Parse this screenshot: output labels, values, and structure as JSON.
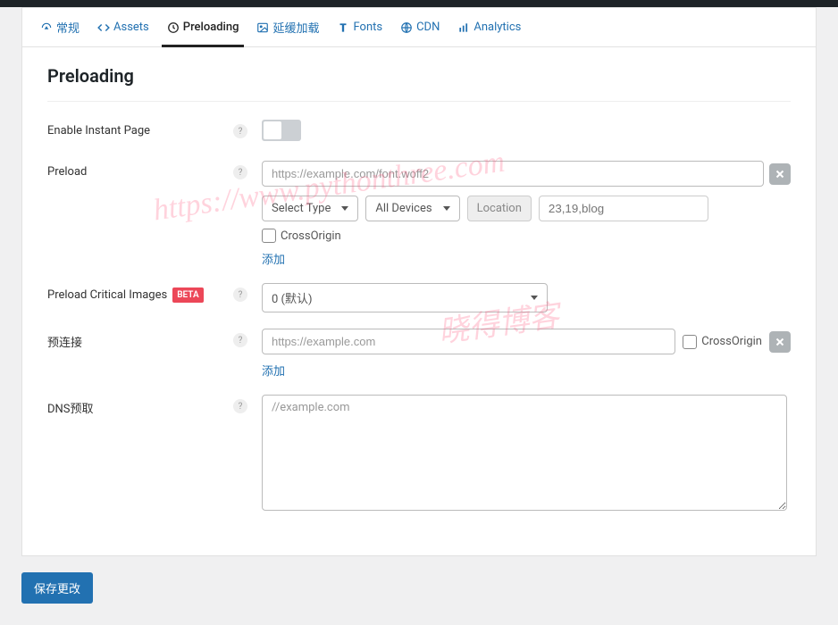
{
  "tabs": {
    "general": "常规",
    "assets": "Assets",
    "preloading": "Preloading",
    "defer": "延缓加载",
    "fonts": "Fonts",
    "cdn": "CDN",
    "analytics": "Analytics"
  },
  "panel": {
    "title": "Preloading"
  },
  "rows": {
    "instant_page": {
      "label": "Enable Instant Page"
    },
    "preload": {
      "label": "Preload",
      "url_placeholder": "https://example.com/font.woff2",
      "select_type": "Select Type",
      "all_devices": "All Devices",
      "location_btn": "Location",
      "location_placeholder": "23,19,blog",
      "crossorigin": "CrossOrigin",
      "add": "添加"
    },
    "preload_critical": {
      "label": "Preload Critical Images",
      "badge": "BETA",
      "value": "0 (默认)"
    },
    "preconnect": {
      "label": "预连接",
      "placeholder": "https://example.com",
      "crossorigin": "CrossOrigin",
      "add": "添加"
    },
    "dns_prefetch": {
      "label": "DNS预取",
      "placeholder": "//example.com"
    }
  },
  "save_button": "保存更改",
  "watermarks": {
    "wm1": "https://www.pythonthree.com",
    "wm2": "晓得博客"
  }
}
